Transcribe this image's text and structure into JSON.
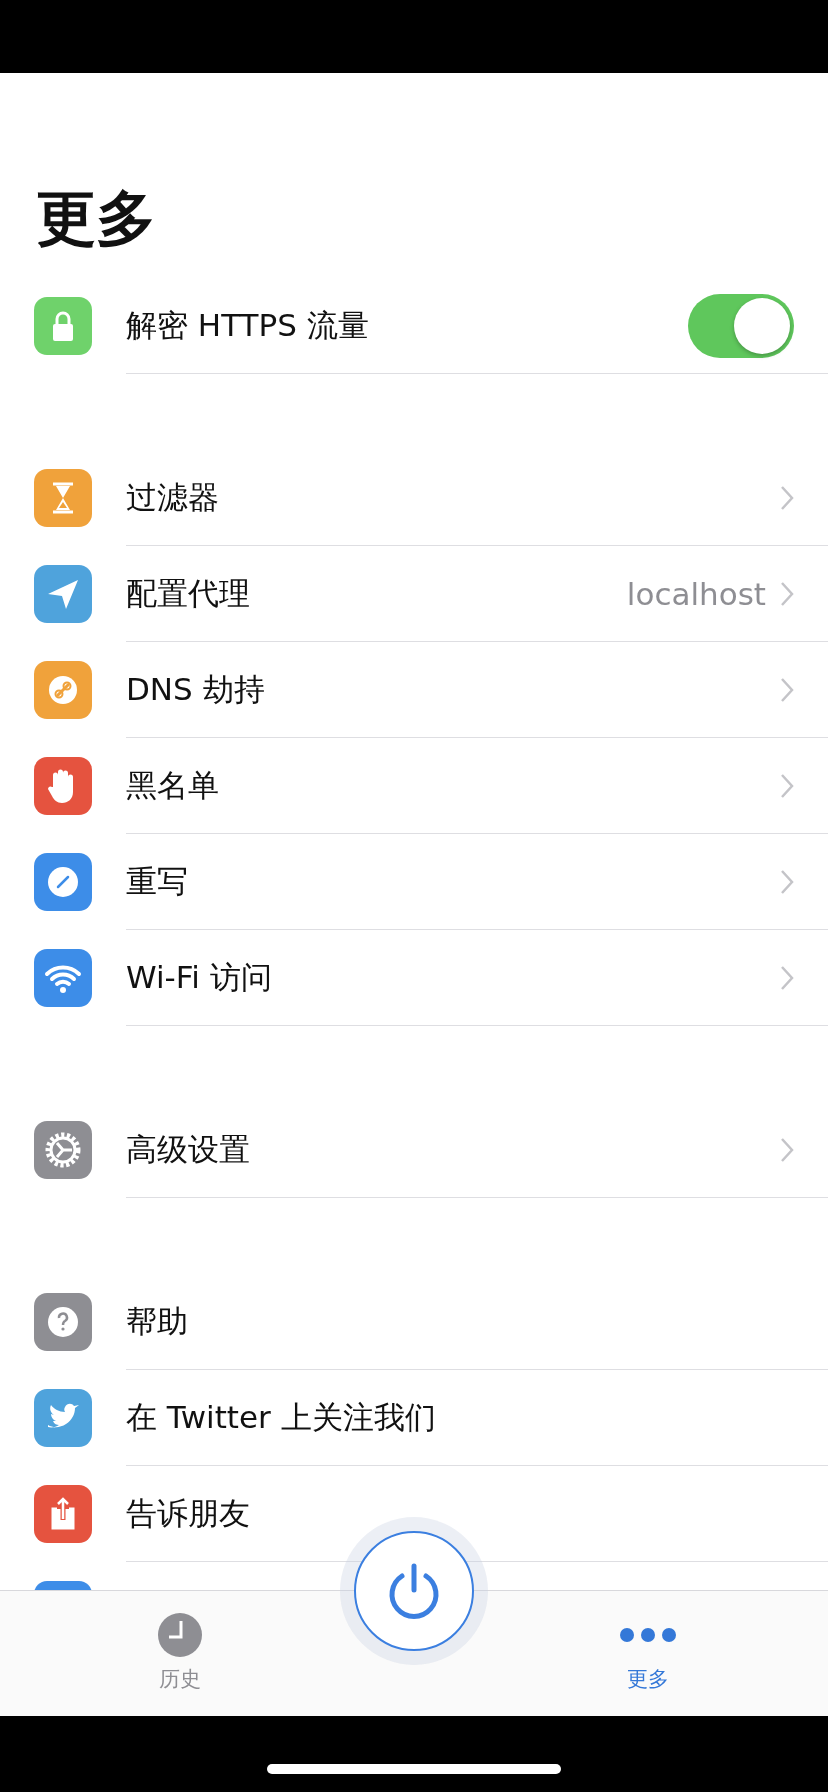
{
  "title": "更多",
  "sections": [
    {
      "rows": [
        {
          "kind": "toggle",
          "label": "解密 HTTPS 流量",
          "color": "#6fd26b",
          "on": true
        }
      ]
    },
    {
      "rows": [
        {
          "kind": "link",
          "label": "过滤器",
          "color": "#f0a23b"
        },
        {
          "kind": "link",
          "label": "配置代理",
          "color": "#4fa3dc",
          "value": "localhost"
        },
        {
          "kind": "link",
          "label": "DNS 劫持",
          "color": "#f0a23b"
        },
        {
          "kind": "link",
          "label": "黑名单",
          "color": "#e5533f"
        },
        {
          "kind": "link",
          "label": "重写",
          "color": "#3d8de8"
        },
        {
          "kind": "link",
          "label": "Wi-Fi 访问",
          "color": "#3d8de8"
        }
      ]
    },
    {
      "rows": [
        {
          "kind": "link",
          "label": "高级设置",
          "color": "#8e8e93"
        }
      ]
    },
    {
      "rows": [
        {
          "kind": "plain",
          "label": "帮助",
          "color": "#8e8e93"
        },
        {
          "kind": "plain",
          "label": "在 Twitter 上关注我们",
          "color": "#4fa3dc"
        },
        {
          "kind": "plain",
          "label": "告诉朋友",
          "color": "#e5533f"
        },
        {
          "kind": "plain",
          "color": "#3d8de8"
        }
      ]
    }
  ],
  "tabs": [
    {
      "label": "历史",
      "selected": false
    },
    {
      "label": "更多",
      "selected": true
    }
  ]
}
